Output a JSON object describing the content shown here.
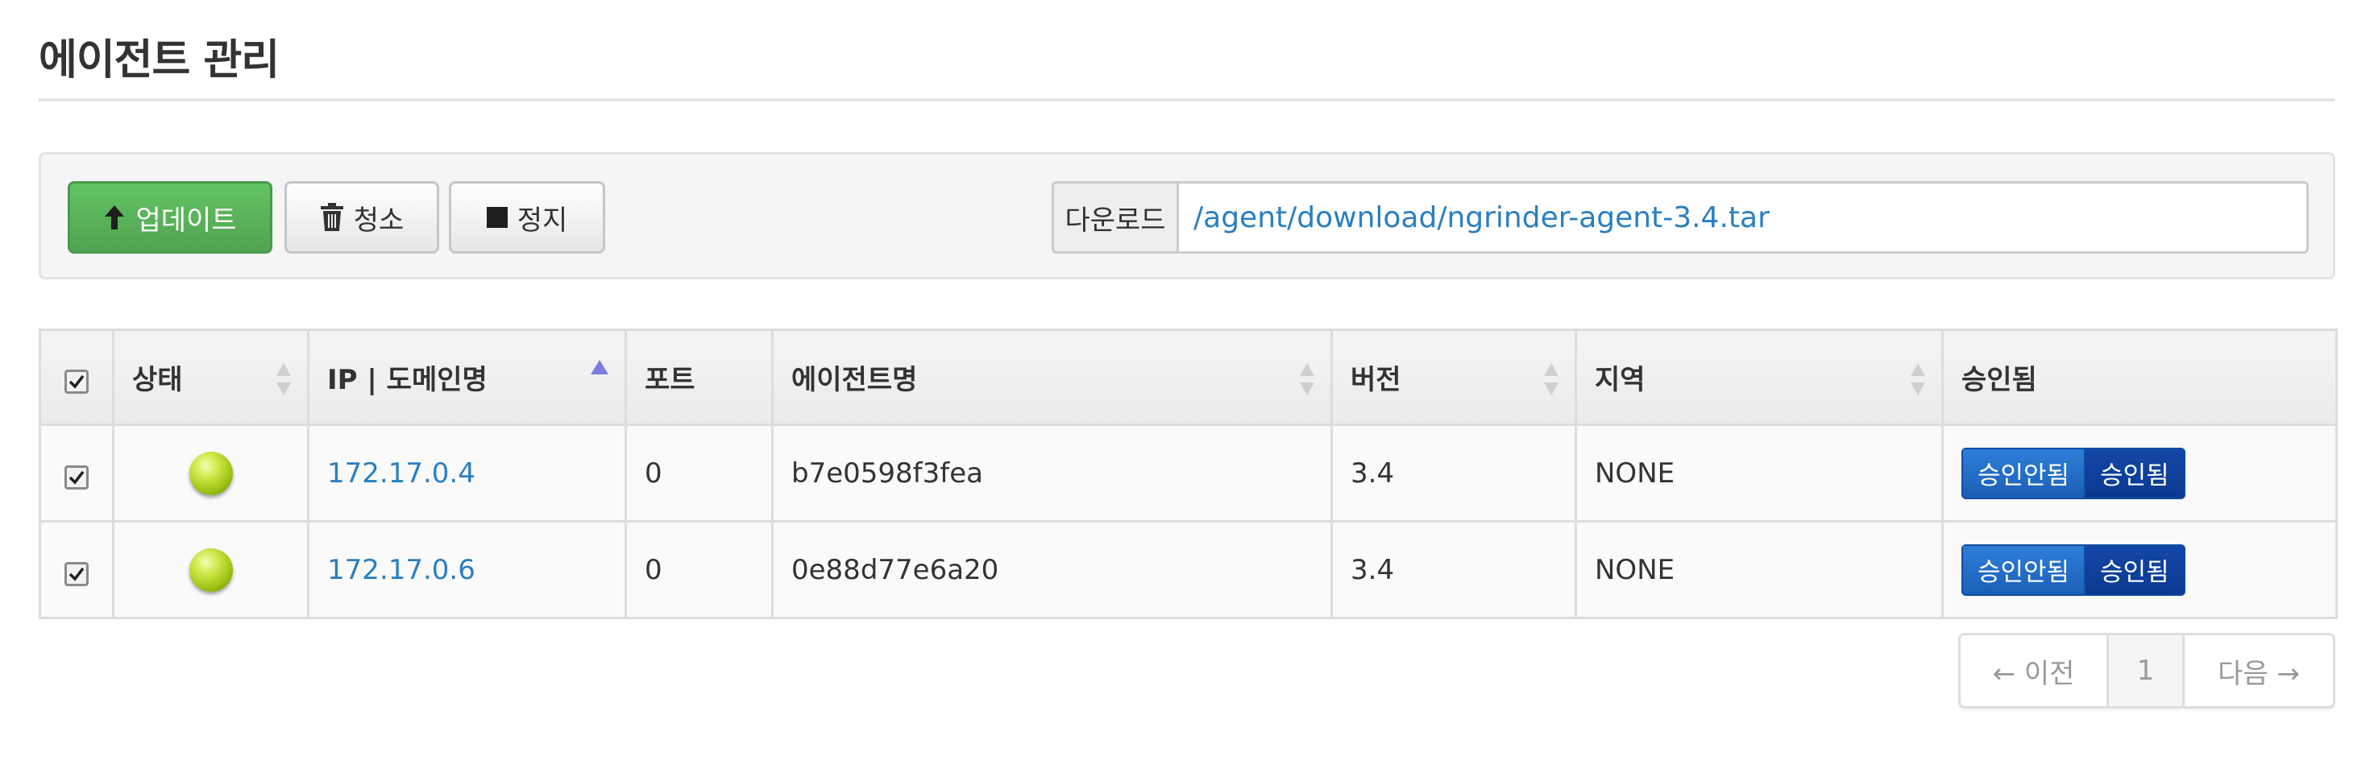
{
  "header": {
    "title": "에이전트 관리"
  },
  "toolbar": {
    "update_label": "업데이트",
    "clean_label": "청소",
    "stop_label": "정지",
    "download_label": "다운로드",
    "download_link": "/agent/download/ngrinder-agent-3.4.tar"
  },
  "table": {
    "headers": {
      "status": "상태",
      "ip": "IP | 도메인명",
      "port": "포트",
      "name": "에이전트명",
      "version": "버전",
      "region": "지역",
      "approved": "승인됨"
    },
    "rows": [
      {
        "checked": true,
        "status": "running",
        "ip": "172.17.0.4",
        "port": "0",
        "name": "b7e0598f3fea",
        "version": "3.4",
        "region": "NONE",
        "disapprove_label": "승인안됨",
        "approve_label": "승인됨"
      },
      {
        "checked": true,
        "status": "running",
        "ip": "172.17.0.6",
        "port": "0",
        "name": "0e88d77e6a20",
        "version": "3.4",
        "region": "NONE",
        "disapprove_label": "승인안됨",
        "approve_label": "승인됨"
      }
    ]
  },
  "pagination": {
    "prev_label": "← 이전",
    "current_page": "1",
    "next_label": "다음 →"
  },
  "colors": {
    "update_button": "#5bb75b",
    "link": "#2a7fc1",
    "approve_active": "#0a3a8f",
    "status_running": "#9cc314"
  }
}
